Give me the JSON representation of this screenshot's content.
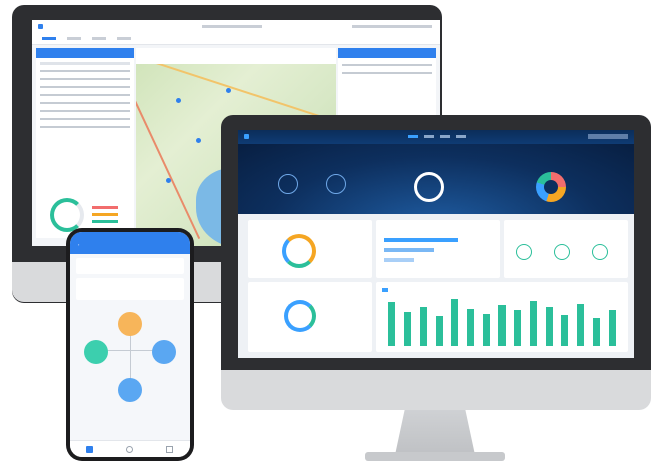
{
  "back_app": {
    "title": "",
    "tabs": [
      "",
      "",
      "",
      ""
    ],
    "table_rows": 8,
    "map_markers": 7
  },
  "front_app": {
    "title": "",
    "nav": [
      "",
      "",
      "",
      ""
    ],
    "panels": [
      "",
      "",
      "",
      "",
      ""
    ],
    "bar_values": [
      70,
      55,
      62,
      48,
      75,
      60,
      52,
      66,
      58,
      72,
      63,
      50,
      68,
      45,
      57
    ]
  },
  "phone_app": {
    "header": "",
    "nodes": [
      "",
      "",
      "",
      ""
    ]
  },
  "colors": {
    "accent": "#2f80ed",
    "teal": "#2bbf9a",
    "orange": "#f5a623",
    "dark_header": "#0f3b74",
    "bezel": "#2d2e31"
  }
}
